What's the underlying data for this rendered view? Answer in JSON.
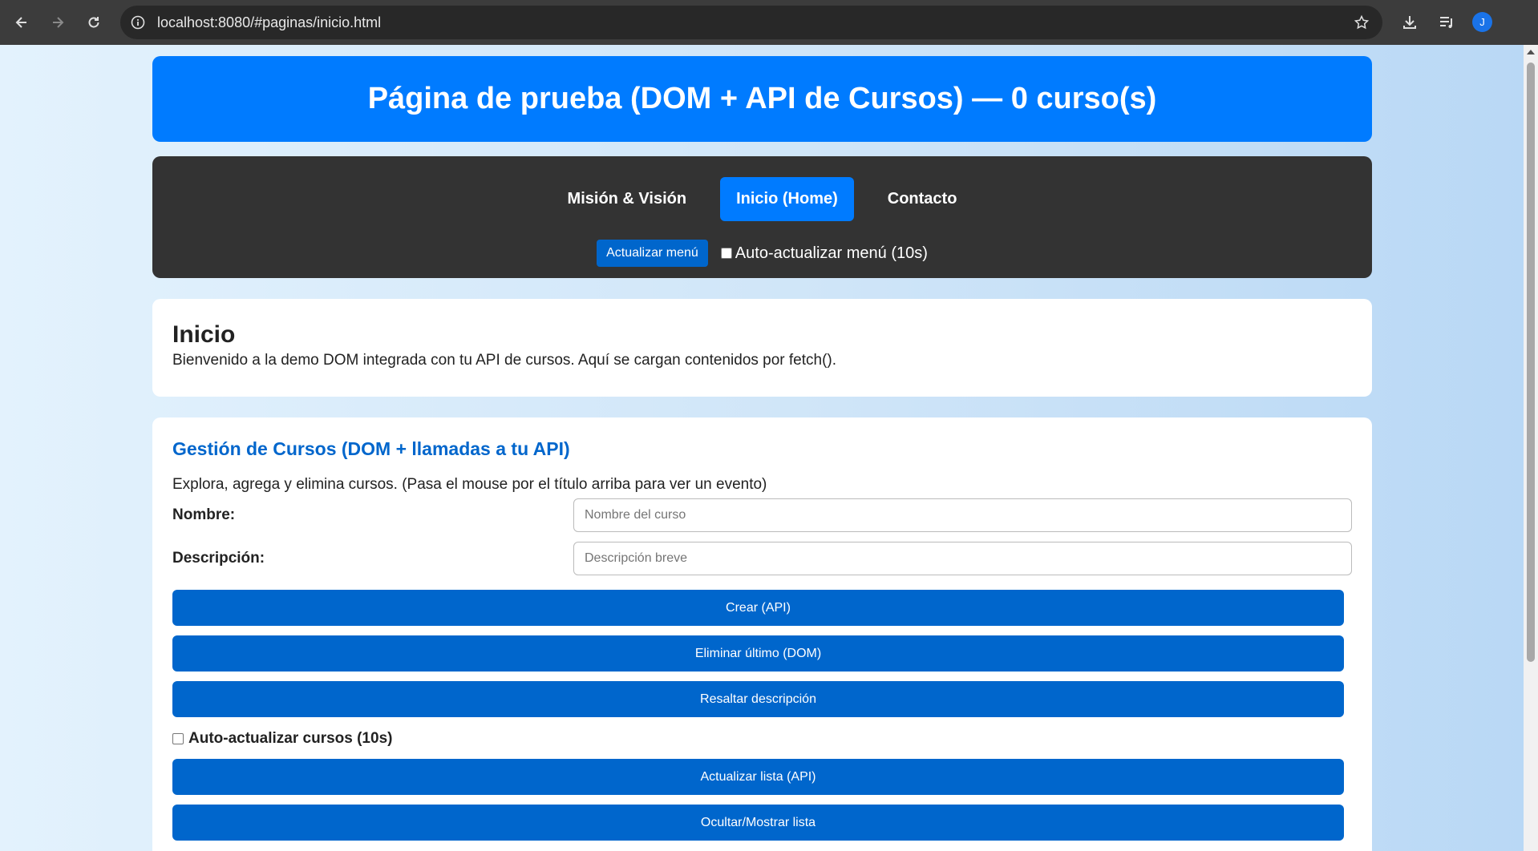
{
  "browser": {
    "url": "localhost:8080/#paginas/inicio.html",
    "profile_initial": "J",
    "icons": [
      "back-arrow-icon",
      "forward-arrow-icon",
      "reload-icon",
      "info-icon",
      "star-icon",
      "download-icon",
      "media-queue-icon"
    ]
  },
  "header": {
    "title": "Página de prueba (DOM + API de Cursos) — 0 curso(s)"
  },
  "menu": {
    "links": [
      {
        "label": "Misión & Visión",
        "active": false
      },
      {
        "label": "Inicio (Home)",
        "active": true
      },
      {
        "label": "Contacto",
        "active": false
      }
    ],
    "refresh_button": "Actualizar menú",
    "auto_refresh_label": "Auto-actualizar menú (10s)"
  },
  "intro": {
    "title": "Inicio",
    "text": "Bienvenido a la demo DOM integrada con tu API de cursos. Aquí se cargan contenidos por fetch()."
  },
  "courses": {
    "title": "Gestión de Cursos (DOM + llamadas a tu API)",
    "description": "Explora, agrega y elimina cursos. (Pasa el mouse por el título arriba para ver un evento)",
    "name_label": "Nombre:",
    "name_placeholder": "Nombre del curso",
    "desc_label": "Descripción:",
    "desc_placeholder": "Descripción breve",
    "create_button": "Crear (API)",
    "delete_button": "Eliminar último (DOM)",
    "highlight_button": "Resaltar descripción",
    "auto_refresh_label": "Auto-actualizar cursos (10s)",
    "refresh_list_button": "Actualizar lista (API)",
    "toggle_list_button": "Ocultar/Mostrar lista"
  },
  "colors": {
    "header": "#007bff",
    "menu_bg": "#333333",
    "button": "#0066cc"
  }
}
